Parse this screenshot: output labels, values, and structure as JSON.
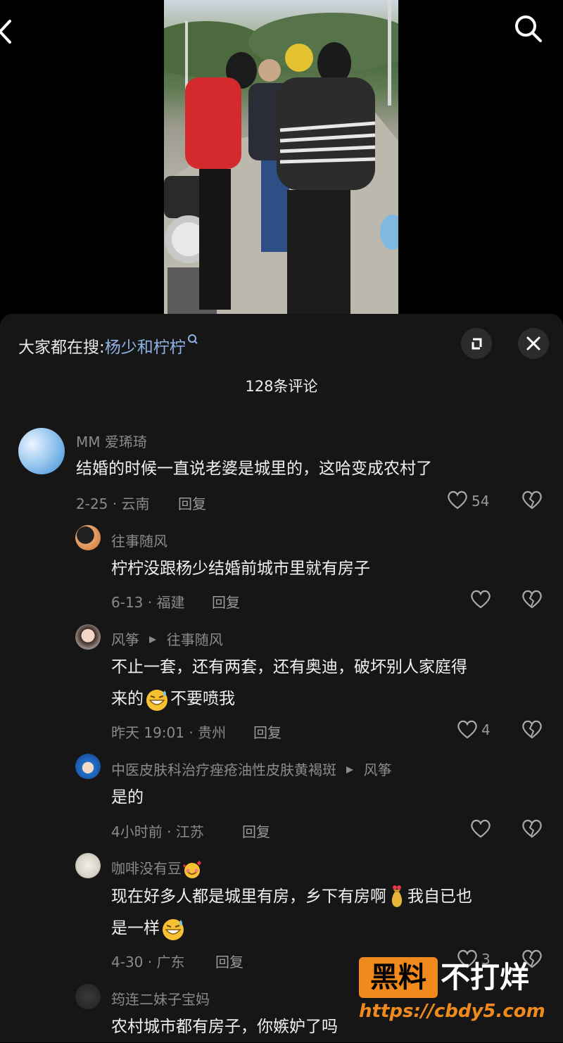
{
  "hot_search": {
    "prefix": "大家都在搜:",
    "keyword": "杨少和柠柠"
  },
  "comment_count": "128条评论",
  "comments": [
    {
      "name": "MM 爱琋琦",
      "text": "结婚的时候一直说老婆是城里的，这哈变成农村了",
      "meta": "2-25 · 云南",
      "reply": "回复",
      "likes": "54"
    },
    {
      "name": "往事随风",
      "text": "柠柠没跟杨少结婚前城市里就有房子",
      "meta": "6-13 · 福建",
      "reply": "回复",
      "likes": ""
    },
    {
      "name": "风筝",
      "reply_to": "往事随风",
      "text1": "不止一套，还有两套，还有奥迪，破坏别人家庭得",
      "text2a": "来的",
      "text2b": "不要喷我",
      "meta": "昨天 19:01 · 贵州",
      "reply": "回复",
      "likes": "4"
    },
    {
      "name": "中医皮肤科治疗痤疮油性皮肤黄褐斑",
      "reply_to": "风筝",
      "text": "是的",
      "meta": "4小时前 · 江苏",
      "reply": "回复",
      "likes": ""
    },
    {
      "name": "咖啡没有豆",
      "text1a": "现在好多人都是城里有房，乡下有房啊",
      "text1b": "我自已也",
      "text2": "是一样",
      "meta": "4-30 · 广东",
      "reply": "回复",
      "likes": "3"
    },
    {
      "name": "筠连二妹子宝妈",
      "text": "农村城市都有房子，你嫉妒了吗"
    }
  ],
  "watermark": {
    "brand": "黑料",
    "slogan": "不打烊",
    "url": "https://cbdy5.com"
  },
  "icons": {
    "back": "chevron-left-icon",
    "search": "search-icon",
    "expand": "expand-icon",
    "close": "close-icon",
    "like": "heart-icon",
    "dislike": "broken-heart-icon",
    "emoji_grin": "grin-sweat-emoji",
    "emoji_love": "smiling-hearts-emoji",
    "emoji_bag": "money-bag-emoji"
  },
  "colors": {
    "sheet_bg": "#161616",
    "keyword": "#8fb3e6",
    "watermark_orange": "#f08a1c"
  }
}
